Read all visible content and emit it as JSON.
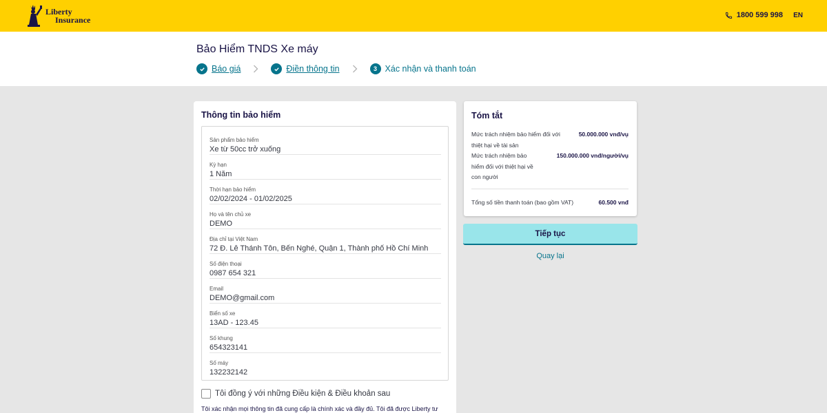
{
  "brand": {
    "line1": "Liberty",
    "line2": "Insurance",
    "color": "#ffd000"
  },
  "topbar": {
    "phone": "1800 599 998",
    "language": "EN"
  },
  "page": {
    "title": "Bảo Hiểm TNDS Xe máy"
  },
  "steps": [
    {
      "label": "Báo giá",
      "state": "done"
    },
    {
      "label": "Điền thông tin",
      "state": "done"
    },
    {
      "number": "3",
      "label": "Xác nhận và thanh toán",
      "state": "current"
    }
  ],
  "insurance_info": {
    "title": "Thông tin bảo hiểm",
    "fields": [
      {
        "label": "Sản phẩm bảo hiểm",
        "value": "Xe từ 50cc trở xuống"
      },
      {
        "label": "Kỳ hạn",
        "value": "1 Năm"
      },
      {
        "label": "Thời hạn bảo hiểm",
        "value": "02/02/2024 - 01/02/2025"
      },
      {
        "label": "Họ và tên chủ xe",
        "value": "DEMO"
      },
      {
        "label": "Địa chỉ tại Việt Nam",
        "value": "72 Đ. Lê Thánh Tôn, Bến Nghé, Quận 1, Thành phố Hồ Chí Minh"
      },
      {
        "label": "Số điện thoại",
        "value": "0987 654 321"
      },
      {
        "label": "Email",
        "value": "DEMO@gmail.com"
      },
      {
        "label": "Biển số xe",
        "value": "13AD - 123.45"
      },
      {
        "label": "Số khung",
        "value": "654323141"
      },
      {
        "label": "Số máy",
        "value": "132232142"
      }
    ],
    "agree_label": "Tôi đồng ý với những Điều kiện & Điều khoản sau",
    "confirm_text": "Tôi xác nhận mọi thông tin đã cung cấp là chính xác và đầy đủ. Tôi đã được Liberty tư"
  },
  "summary": {
    "title": "Tóm tắt",
    "rows": [
      {
        "label_lines": [
          "Mức trách nhiệm bảo hiểm đối với",
          "thiệt hại về tài sản"
        ],
        "value": "50.000.000 vnđ/vụ"
      },
      {
        "label_lines": [
          "Mức trách nhiệm bảo",
          "hiểm đối với thiệt hại về",
          "con người"
        ],
        "value": "150.000.000 vnđ/người/vụ"
      }
    ],
    "total_label": "Tổng số tiền thanh toán (bao gồm VAT)",
    "total_value": "60.500 vnđ"
  },
  "actions": {
    "continue_label": "Tiếp tục",
    "back_label": "Quay lại"
  },
  "colors": {
    "accent": "#06748c",
    "navy": "#1a1446",
    "button": "#99e5ea"
  }
}
